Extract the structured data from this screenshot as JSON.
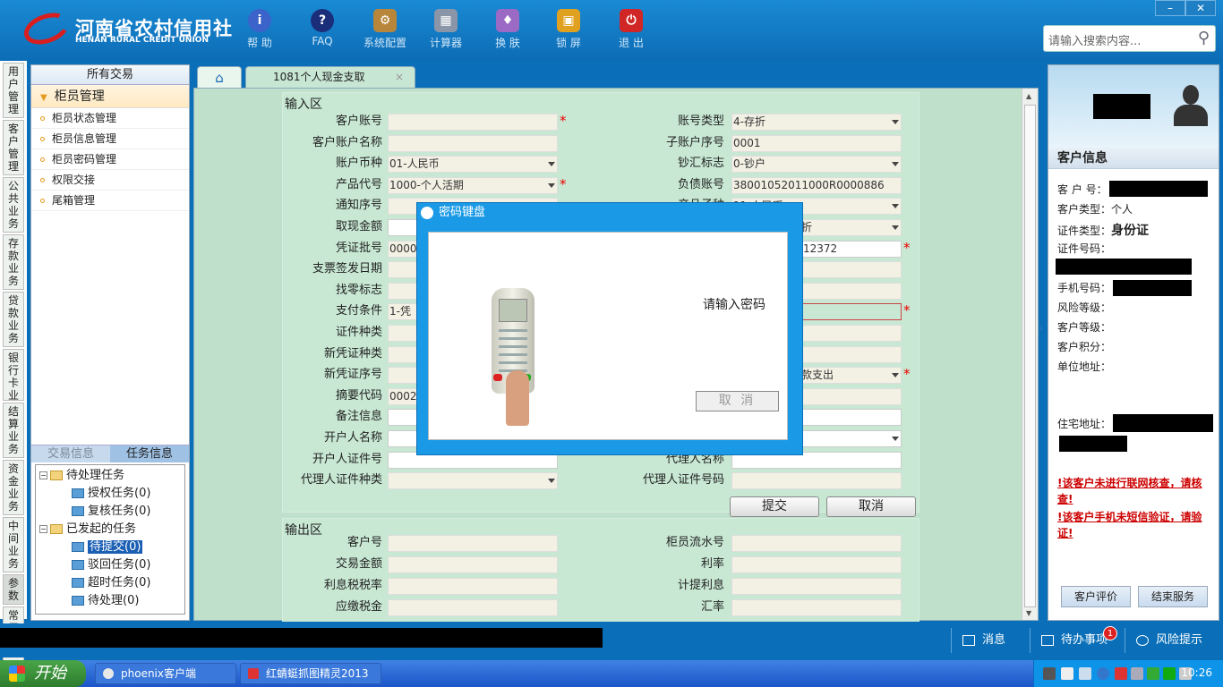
{
  "header": {
    "logo_cn": "河南省农村信用社",
    "logo_en": "HENAN RURAL CREDIT UNION",
    "tools": [
      {
        "label": "帮 助",
        "icon": "info-icon"
      },
      {
        "label": "FAQ",
        "icon": "question-icon"
      },
      {
        "label": "系统配置",
        "icon": "toolbox-icon"
      },
      {
        "label": "计算器",
        "icon": "calculator-icon"
      },
      {
        "label": "换 肤",
        "icon": "shirt-icon"
      },
      {
        "label": "锁 屏",
        "icon": "lock-icon"
      },
      {
        "label": "退 出",
        "icon": "power-icon"
      }
    ],
    "search_placeholder": "请输入搜索内容...",
    "win_min": "–",
    "win_close": "✕"
  },
  "vtabs": [
    "用户管理",
    "客户管理",
    "公共业务",
    "存款业务",
    "贷款业务",
    "银行卡业务",
    "结算业务",
    "资金业务",
    "中间业务",
    "参数",
    "常用工具"
  ],
  "left_panel": {
    "header": "所有交易",
    "group": "柜员管理",
    "items": [
      "柜员状态管理",
      "柜员信息管理",
      "柜员密码管理",
      "权限交接",
      "尾箱管理"
    ],
    "tab_trade": "交易信息",
    "tab_task": "任务信息",
    "tree": {
      "pending": "待处理任务",
      "pending_children": [
        "授权任务(0)",
        "复核任务(0)"
      ],
      "initiated": "已发起的任务",
      "initiated_children": [
        "待提交(0)",
        "驳回任务(0)",
        "超时任务(0)",
        "待处理(0)"
      ]
    }
  },
  "tabs": {
    "active": "1081个人现金支取",
    "close": "×"
  },
  "form": {
    "input_title": "输入区",
    "left_labels": [
      "客户账号",
      "客户账户名称",
      "账户币种",
      "产品代号",
      "通知序号",
      "取现金额",
      "凭证批号",
      "支票签发日期",
      "找零标志",
      "支付条件",
      "证件种类",
      "新凭证种类",
      "新凭证序号",
      "摘要代码",
      "备注信息",
      "开户人名称",
      "开户人证件号",
      "代理人证件种类"
    ],
    "left_values": [
      "",
      "",
      "01-人民币",
      "1000-个人活期",
      "",
      "",
      "0000",
      "",
      "",
      "1-凭",
      "",
      "",
      "",
      "00020",
      "",
      "",
      "",
      ""
    ],
    "right_labels": [
      "账号类型",
      "子账户序号",
      "钞汇标志",
      "负债账号",
      "产品子种",
      "",
      "",
      "",
      "",
      "",
      "",
      "",
      "",
      "",
      "",
      "",
      "代理人名称",
      "代理人证件号码"
    ],
    "right_values": [
      "4-存折",
      "0001",
      "0-钞户",
      "38001052011000R0000886",
      "11-人民币",
      "折",
      "12372",
      "",
      "",
      "",
      "",
      "",
      "款支出",
      "",
      "",
      "",
      "",
      ""
    ],
    "submit": "提交",
    "cancel": "取消",
    "output_title": "输出区",
    "out_left_labels": [
      "客户号",
      "交易金额",
      "利息税税率",
      "应缴税金"
    ],
    "out_right_labels": [
      "柜员流水号",
      "利率",
      "计提利息",
      "汇率"
    ]
  },
  "dialog": {
    "title": "密码键盘",
    "message": "请输入密码",
    "cancel": "取 消"
  },
  "customer": {
    "title": "客户信息",
    "fields": [
      "客 户 号：",
      "客户类型：",
      "证件类型：",
      "证件号码：",
      "手机号码：",
      "风险等级：",
      "客户等级：",
      "客户积分：",
      "单位地址：",
      "住宅地址："
    ],
    "type_value": "个人",
    "id_type_value": "身份证",
    "warn1": "!该客户未进行联网核查，请核查!",
    "warn2": "!该客户手机未短信验证，请验证!",
    "btn_eval": "客户评价",
    "btn_end": "结束服务"
  },
  "statusbar": {
    "msg": "消息",
    "todo": "待办事项",
    "todo_count": "1",
    "risk": "风险提示"
  },
  "taskbar": {
    "start": "开始",
    "items": [
      "phoenix客户端",
      "红蜻蜓抓图精灵2013"
    ],
    "clock": "10:26"
  }
}
